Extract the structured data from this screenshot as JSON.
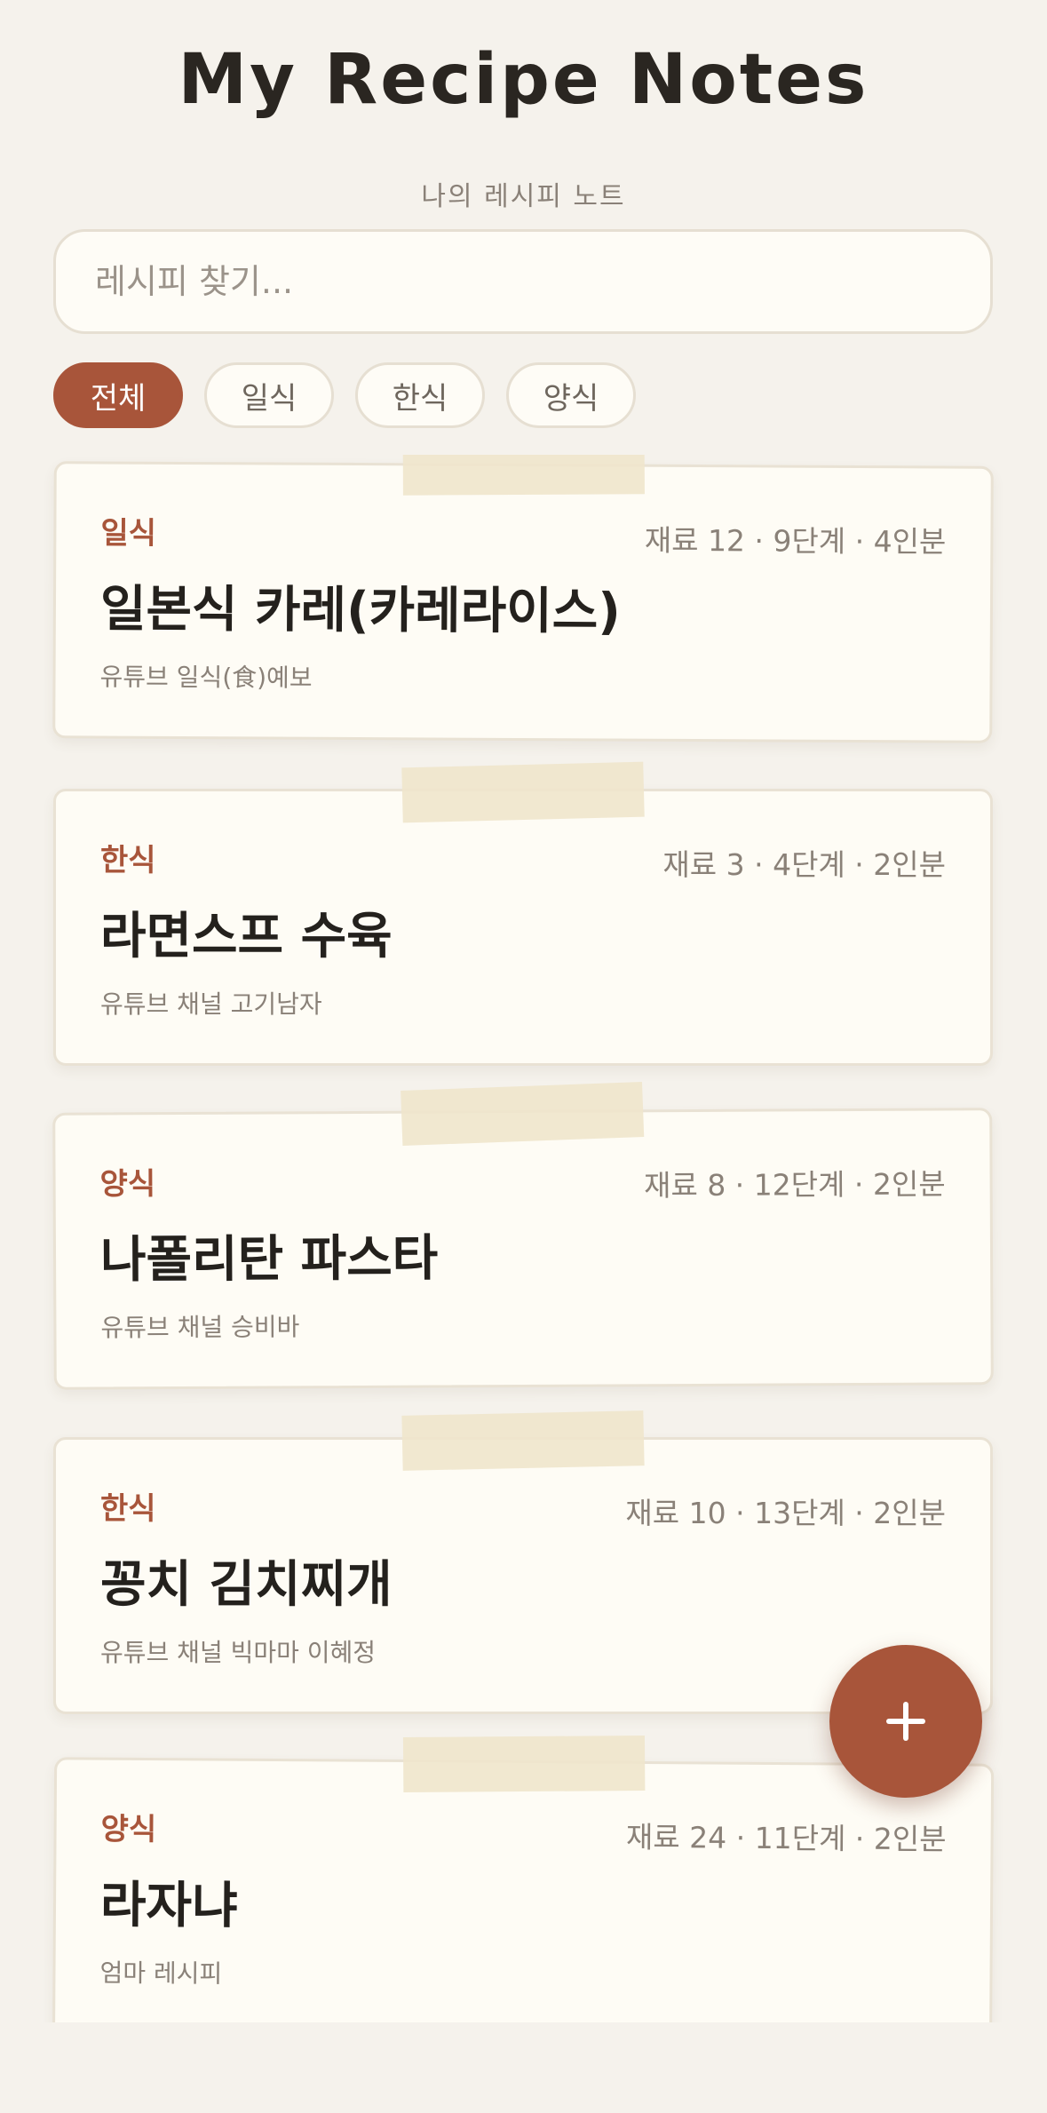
{
  "header": {
    "title": "My Recipe Notes",
    "subtitle": "나의 레시피 노트"
  },
  "search": {
    "placeholder": "레시피 찾기...",
    "value": ""
  },
  "filters": [
    {
      "label": "전체",
      "active": true
    },
    {
      "label": "일식",
      "active": false
    },
    {
      "label": "한식",
      "active": false
    },
    {
      "label": "양식",
      "active": false
    }
  ],
  "recipes": [
    {
      "category": "일식",
      "meta": "재료 12 · 9단계 · 4인분",
      "title": "일본식 카레(카레라이스)",
      "source": "유튜브 일식(食)예보"
    },
    {
      "category": "한식",
      "meta": "재료 3 · 4단계 · 2인분",
      "title": "라면스프 수육",
      "source": "유튜브 채널 고기남자"
    },
    {
      "category": "양식",
      "meta": "재료 8 · 12단계 · 2인분",
      "title": "나폴리탄 파스타",
      "source": "유튜브 채널 승비바"
    },
    {
      "category": "한식",
      "meta": "재료 10 · 13단계 · 2인분",
      "title": "꽁치 김치찌개",
      "source": "유튜브 채널 빅마마 이혜정"
    },
    {
      "category": "양식",
      "meta": "재료 24 · 11단계 · 2인분",
      "title": "라자냐",
      "source": "엄마 레시피"
    }
  ],
  "fab": {
    "icon": "plus-icon"
  },
  "colors": {
    "accent": "#a8553a",
    "background": "#f5f2ec",
    "card": "#fefcf5",
    "tape": "#efe5cc"
  }
}
